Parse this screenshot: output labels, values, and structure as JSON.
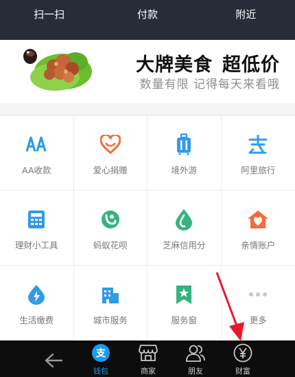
{
  "top_bar": {
    "items": [
      {
        "label": "扫一扫"
      },
      {
        "label": "付款"
      },
      {
        "label": "附近"
      }
    ]
  },
  "banner": {
    "headline_1": "大牌美食",
    "headline_2": "超低价",
    "subline": "数量有限 记得每天来看哦"
  },
  "services": [
    {
      "label": "AA收款",
      "icon": "aa-icon",
      "color": "#2f9bea"
    },
    {
      "label": "爱心捐赠",
      "icon": "heart-icon",
      "color": "#f36b39"
    },
    {
      "label": "境外游",
      "icon": "luggage-icon",
      "color": "#2f9bea"
    },
    {
      "label": "阿里旅行",
      "icon": "travel-icon",
      "color": "#2f9bea"
    },
    {
      "label": "理财小工具",
      "icon": "calculator-icon",
      "color": "#2f9bea"
    },
    {
      "label": "蚂蚁花呗",
      "icon": "huabei-icon",
      "color": "#36b37e"
    },
    {
      "label": "芝麻信用分",
      "icon": "sesame-icon",
      "color": "#36b37e"
    },
    {
      "label": "亲情账户",
      "icon": "family-heart-icon",
      "color": "#f36b39"
    },
    {
      "label": "生活缴费",
      "icon": "utility-drop-icon",
      "color": "#2f9bea"
    },
    {
      "label": "城市服务",
      "icon": "city-building-icon",
      "color": "#2f9bea"
    },
    {
      "label": "服务窗",
      "icon": "service-window-icon",
      "color": "#36b37e"
    },
    {
      "label": "更多",
      "icon": "more-dots-icon",
      "color": "#c8c8c8"
    }
  ],
  "tab_bar": {
    "back_icon": "back-arrow-icon",
    "tabs": [
      {
        "label": "钱包",
        "icon": "wallet-icon",
        "active": true
      },
      {
        "label": "商家",
        "icon": "shop-icon",
        "active": false
      },
      {
        "label": "朋友",
        "icon": "friends-icon",
        "active": false
      },
      {
        "label": "财富",
        "icon": "yen-icon",
        "active": false
      }
    ],
    "active_color": "#1a9bf0"
  },
  "annotation": {
    "color": "#e8192c"
  }
}
